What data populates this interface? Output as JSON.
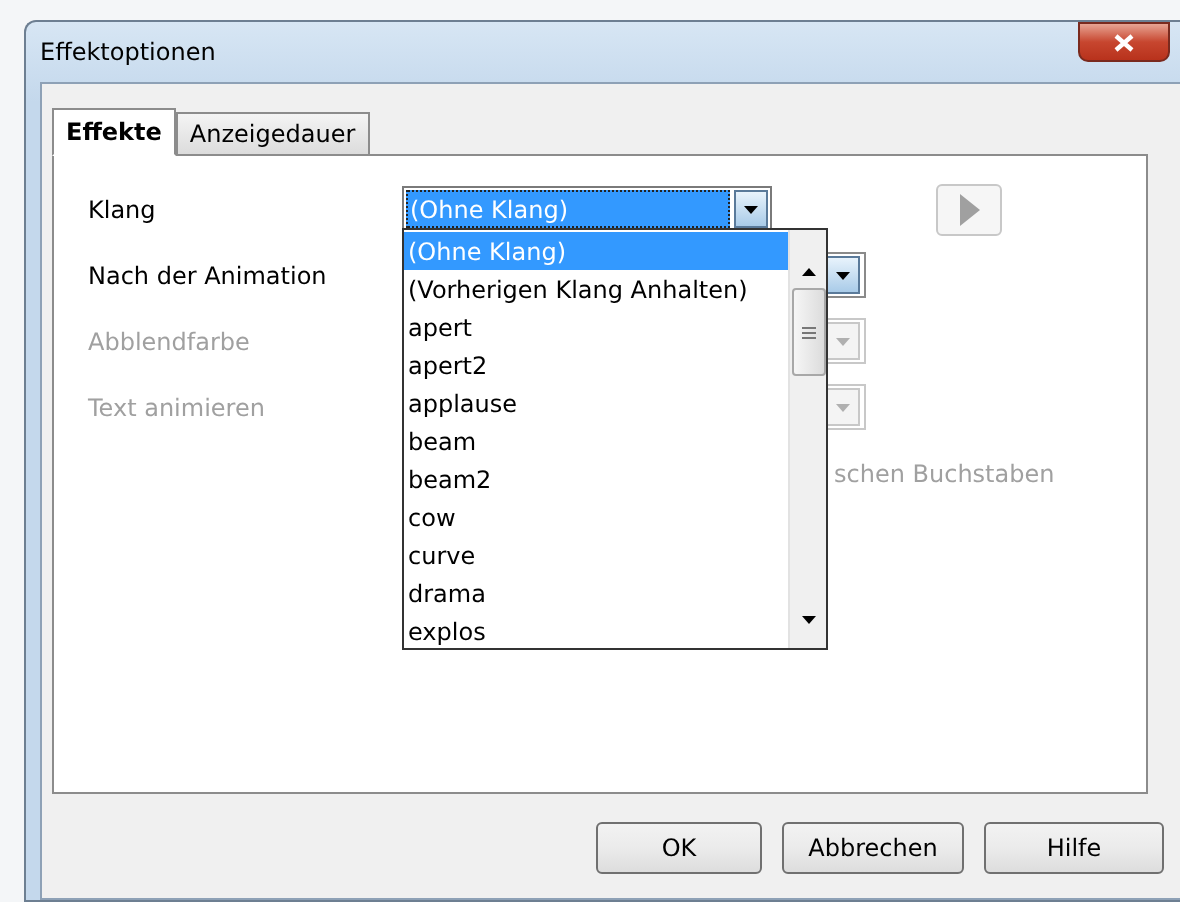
{
  "window": {
    "title": "Effektoptionen"
  },
  "tabs": [
    {
      "label": "Effekte",
      "selected": true
    },
    {
      "label": "Anzeigedauer",
      "selected": false
    }
  ],
  "rows": [
    {
      "label": "Klang",
      "disabled": false,
      "value": "(Ohne Klang)"
    },
    {
      "label": "Nach der Animation",
      "disabled": false
    },
    {
      "label": "Abblendfarbe",
      "disabled": true
    },
    {
      "label": "Text animieren",
      "disabled": true
    }
  ],
  "hidden_option": {
    "label": "schen Buchstaben",
    "disabled": true
  },
  "dropdown": {
    "items": [
      {
        "label": "(Ohne Klang)",
        "selected": true
      },
      {
        "label": "(Vorherigen Klang Anhalten)",
        "selected": false
      },
      {
        "label": "apert",
        "selected": false
      },
      {
        "label": "apert2",
        "selected": false
      },
      {
        "label": "applause",
        "selected": false
      },
      {
        "label": "beam",
        "selected": false
      },
      {
        "label": "beam2",
        "selected": false
      },
      {
        "label": "cow",
        "selected": false
      },
      {
        "label": "curve",
        "selected": false
      },
      {
        "label": "drama",
        "selected": false
      },
      {
        "label": "explos",
        "selected": false
      }
    ]
  },
  "buttons": [
    "OK",
    "Abbrechen",
    "Hilfe"
  ]
}
